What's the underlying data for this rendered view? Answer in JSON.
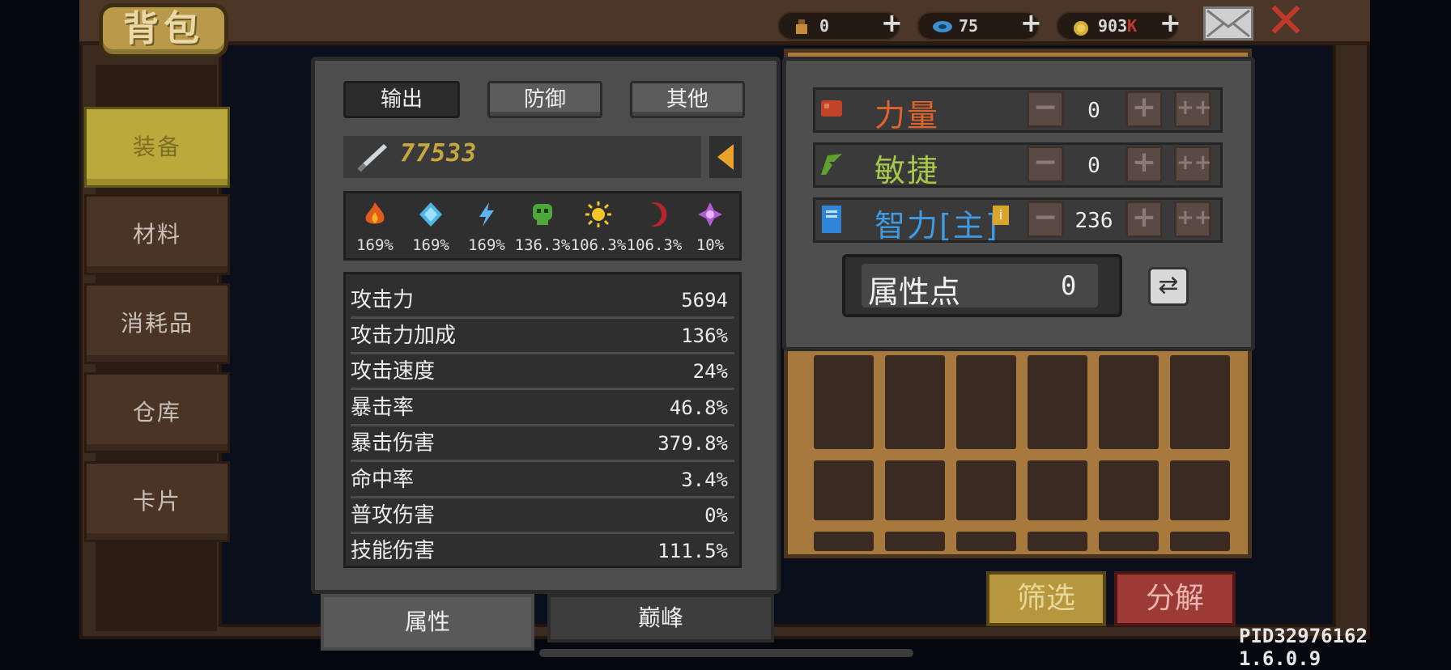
{
  "header": {
    "title": "背包",
    "currencies": [
      {
        "icon": "potion-icon",
        "value": "0"
      },
      {
        "icon": "gem-icon",
        "value": "75"
      },
      {
        "icon": "coin-icon",
        "value": "903",
        "suffix": "K"
      }
    ],
    "plus": "+"
  },
  "sidebar": {
    "items": [
      {
        "label": "装备",
        "active": true
      },
      {
        "label": "材料"
      },
      {
        "label": "消耗品"
      },
      {
        "label": "仓库"
      },
      {
        "label": "卡片"
      }
    ]
  },
  "stats_panel": {
    "tabs": [
      {
        "label": "输出",
        "active": true
      },
      {
        "label": "防御"
      },
      {
        "label": "其他"
      }
    ],
    "power": "77533",
    "elements": [
      {
        "icon": "fire-icon",
        "value": "169%"
      },
      {
        "icon": "ice-icon",
        "value": "169%"
      },
      {
        "icon": "lightning-icon",
        "value": "169%"
      },
      {
        "icon": "poison-skull-icon",
        "value": "136.3%"
      },
      {
        "icon": "light-sun-icon",
        "value": "106.3%"
      },
      {
        "icon": "dark-moon-icon",
        "value": "106.3%"
      },
      {
        "icon": "arcane-icon",
        "value": "10%"
      }
    ],
    "rows": [
      {
        "label": "攻击力",
        "value": "5694"
      },
      {
        "label": "攻击力加成",
        "value": "136%"
      },
      {
        "label": "攻击速度",
        "value": "24%"
      },
      {
        "label": "暴击率",
        "value": "46.8%"
      },
      {
        "label": "暴击伤害",
        "value": "379.8%"
      },
      {
        "label": "命中率",
        "value": "3.4%"
      },
      {
        "label": "普攻伤害",
        "value": "0%"
      },
      {
        "label": "技能伤害",
        "value": "111.5%"
      }
    ],
    "bottom_tabs": [
      {
        "label": "属性",
        "active": true
      },
      {
        "label": "巅峰"
      }
    ]
  },
  "attributes": {
    "rows": [
      {
        "label": "力量",
        "value": "0",
        "color": "#e0632c",
        "icon": "fist-icon"
      },
      {
        "label": "敏捷",
        "value": "0",
        "color": "#a9c84a",
        "icon": "feather-icon"
      },
      {
        "label": "智力[主]",
        "value": "236",
        "color": "#3f9be3",
        "icon": "book-icon"
      }
    ],
    "points_label": "属性点",
    "points_value": "0"
  },
  "actions": {
    "filter": "筛选",
    "decompose": "分解"
  },
  "footer": {
    "version": "PID32976162 1.6.0.9"
  },
  "colors": {
    "gold_text": "#c7a640",
    "active_tab": "#bba93c",
    "danger": "#9c3a36"
  }
}
